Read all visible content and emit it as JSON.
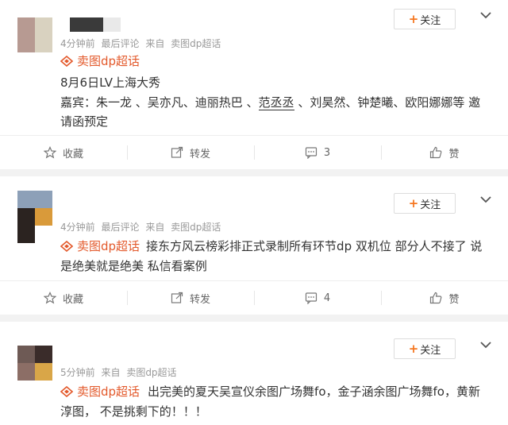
{
  "colors": {
    "accent": "#e3592b",
    "plus": "#f5761f",
    "background": "#f2f2f2"
  },
  "posts": [
    {
      "meta": {
        "time": "4分钟前",
        "last_comment": "最后评论",
        "from_label": "来自",
        "source": "卖图dp超话"
      },
      "follow_label": "关注",
      "topic": "卖图dp超话",
      "lines": [
        "8月6日LV上海大秀",
        "嘉宾：朱一龙 、吴亦凡、迪丽热巴 、",
        "范丞丞",
        " 、刘昊然、钟楚曦、欧阳娜娜等 邀",
        "请函预定"
      ],
      "actions": {
        "favorite": "收藏",
        "repost": "转发",
        "comments": "3",
        "like": "赞"
      }
    },
    {
      "meta": {
        "time": "4分钟前",
        "last_comment": "最后评论",
        "from_label": "来自",
        "source": "卖图dp超话"
      },
      "follow_label": "关注",
      "topic": "卖图dp超话",
      "lines": [
        "接东方风云榜彩排正式录制所有环节dp 双机位 部分人不接了 说",
        "是绝美就是绝美 私信看案例"
      ],
      "actions": {
        "favorite": "收藏",
        "repost": "转发",
        "comments": "4",
        "like": "赞"
      }
    },
    {
      "meta": {
        "time": "5分钟前",
        "from_label": "来自",
        "source": "卖图dp超话"
      },
      "follow_label": "关注",
      "topic": "卖图dp超话",
      "lines": [
        "出完美的夏天吴宣仪余图广场舞fo，金子涵余图广场舞fo，黄新",
        "淳图， 不是挑剩下的！！！"
      ]
    }
  ]
}
